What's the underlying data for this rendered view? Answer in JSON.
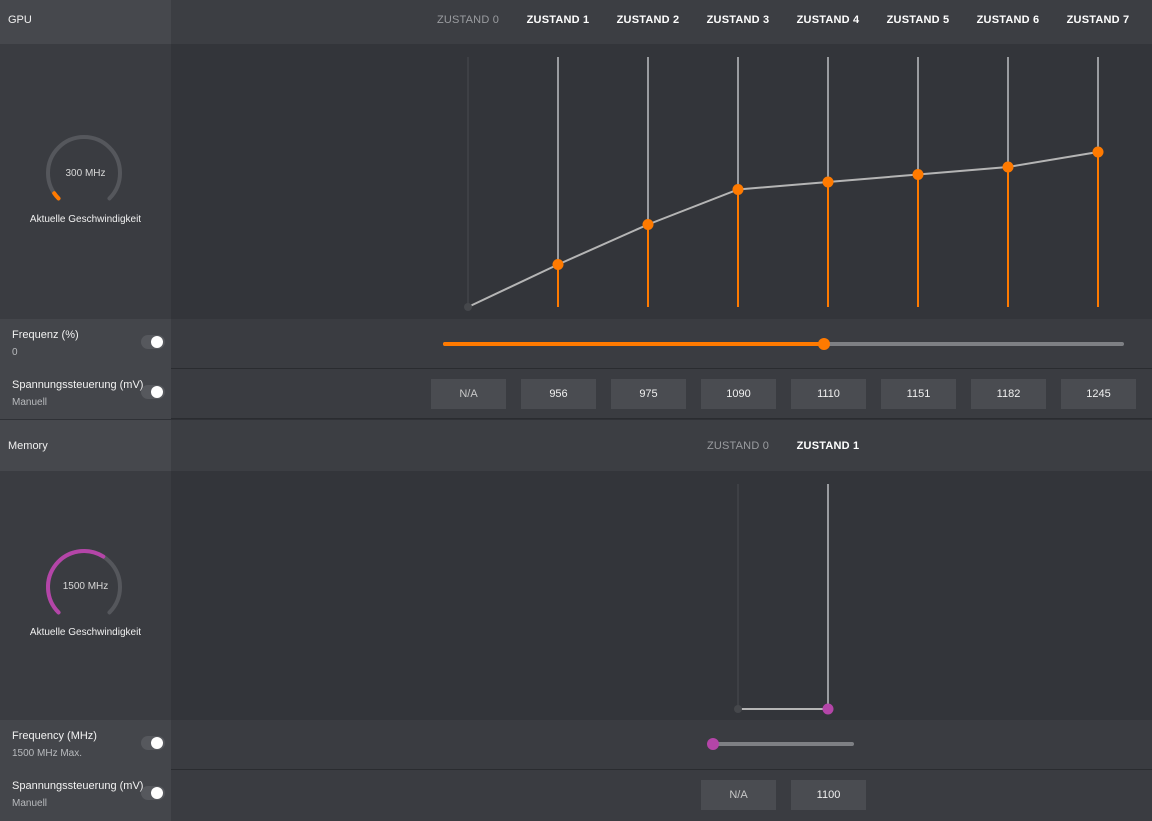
{
  "colors": {
    "gpu_accent": "#ff7a00",
    "memory_accent": "#b445a8",
    "vline": "#9a9ca0",
    "line": "#b5b5b5"
  },
  "gpu": {
    "title": "GPU",
    "states": [
      "ZUSTAND 0",
      "ZUSTAND 1",
      "ZUSTAND 2",
      "ZUSTAND 3",
      "ZUSTAND 4",
      "ZUSTAND 5",
      "ZUSTAND 6",
      "ZUSTAND 7"
    ],
    "active_states": [
      false,
      true,
      true,
      true,
      true,
      true,
      true,
      true
    ],
    "gauge": {
      "value_text": "300 MHz",
      "caption": "Aktuelle Geschwindigkeit",
      "icon": "gpu-speed-gauge",
      "fraction": 0.04
    },
    "curve_levels": [
      0.0,
      0.17,
      0.33,
      0.47,
      0.5,
      0.53,
      0.56,
      0.62
    ],
    "freq": {
      "label": "Frequenz (%)",
      "sub": "0",
      "fraction": 0.56
    },
    "voltage": {
      "label": "Spannungssteuerung (mV)",
      "sub": "Manuell",
      "values": [
        "N/A",
        "956",
        "975",
        "1090",
        "1110",
        "1151",
        "1182",
        "1245"
      ]
    }
  },
  "memory": {
    "title": "Memory",
    "states": [
      "ZUSTAND 0",
      "ZUSTAND 1"
    ],
    "active_states": [
      false,
      true
    ],
    "gauge": {
      "value_text": "1500 MHz",
      "caption": "Aktuelle Geschwindigkeit",
      "icon": "memory-speed-gauge",
      "fraction": 0.62
    },
    "freq": {
      "label": "Frequency (MHz)",
      "sub": "1500 MHz Max.",
      "fraction": 0.0
    },
    "voltage": {
      "label": "Spannungssteuerung (mV)",
      "sub": "Manuell",
      "values": [
        "N/A",
        "1100"
      ]
    }
  }
}
